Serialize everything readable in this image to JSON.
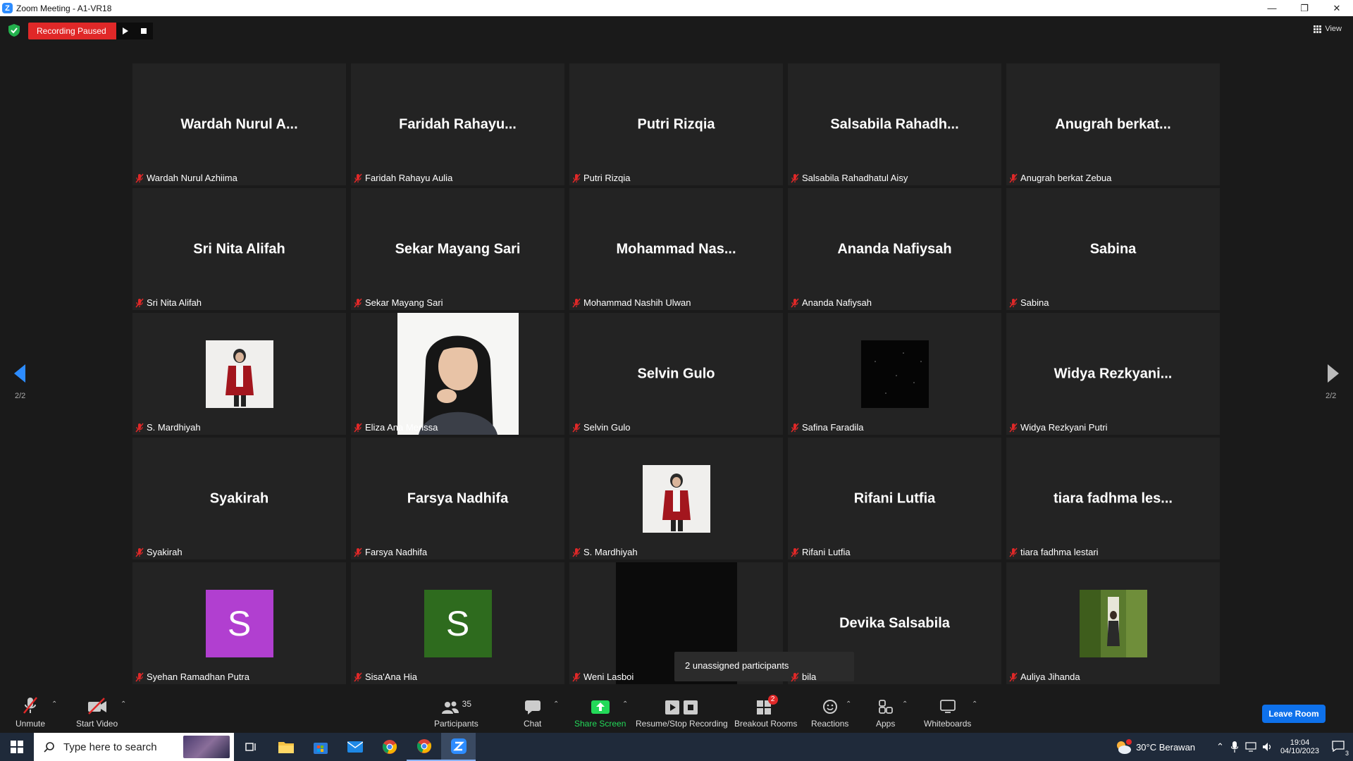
{
  "window": {
    "title": "Zoom Meeting - A1-VR18",
    "minimize": "—",
    "restore": "❐",
    "close": "✕"
  },
  "topbar": {
    "recording_status": "Recording Paused",
    "view_label": "View"
  },
  "pager": {
    "left": "2/2",
    "right": "2/2"
  },
  "tiles": [
    {
      "display": "Wardah  Nurul  A...",
      "name": "Wardah Nurul Azhiima",
      "kind": "name"
    },
    {
      "display": "Faridah  Rahayu...",
      "name": "Faridah Rahayu Aulia",
      "kind": "name"
    },
    {
      "display": "Putri Rizqia",
      "name": "Putri Rizqia",
      "kind": "name"
    },
    {
      "display": "Salsabila  Rahadh...",
      "name": "Salsabila Rahadhatul Aisy",
      "kind": "name"
    },
    {
      "display": "Anugrah  berkat...",
      "name": "Anugrah berkat Zebua",
      "kind": "name"
    },
    {
      "display": "Sri Nita Alifah",
      "name": "Sri Nita Alifah",
      "kind": "name"
    },
    {
      "display": "Sekar Mayang Sari",
      "name": "Sekar Mayang Sari",
      "kind": "name"
    },
    {
      "display": "Mohammad  Nas...",
      "name": "Mohammad Nashih Ulwan",
      "kind": "name"
    },
    {
      "display": "Ananda Nafiysah",
      "name": "Ananda Nafiysah",
      "kind": "name"
    },
    {
      "display": "Sabina",
      "name": "Sabina",
      "kind": "name"
    },
    {
      "display": "",
      "name": "S. Mardhiyah",
      "kind": "photo-red"
    },
    {
      "display": "",
      "name": "Eliza Ana Merissa",
      "kind": "video"
    },
    {
      "display": "Selvin Gulo",
      "name": "Selvin Gulo",
      "kind": "name"
    },
    {
      "display": "",
      "name": "Safina Faradila",
      "kind": "photo-dark"
    },
    {
      "display": "Widya  Rezkyani...",
      "name": "Widya Rezkyani Putri",
      "kind": "name"
    },
    {
      "display": "Syakirah",
      "name": "Syakirah",
      "kind": "name"
    },
    {
      "display": "Farsya Nadhifa",
      "name": "Farsya Nadhifa",
      "kind": "name"
    },
    {
      "display": "",
      "name": "S. Mardhiyah",
      "kind": "photo-red"
    },
    {
      "display": "Rifani Lutfia",
      "name": "Rifani Lutfia",
      "kind": "name"
    },
    {
      "display": "tiara fadhma les...",
      "name": "tiara fadhma lestari",
      "kind": "name"
    },
    {
      "display": "S",
      "name": "Syehan Ramadhan Putra",
      "kind": "letter",
      "color": "#b13fd0"
    },
    {
      "display": "S",
      "name": "Sisa'Ana Hia",
      "kind": "letter",
      "color": "#2e6b1e"
    },
    {
      "display": "",
      "name": "Weni Lasboi",
      "kind": "dark-video"
    },
    {
      "display": "Devika Salsabila",
      "name": "bila",
      "kind": "name"
    },
    {
      "display": "",
      "name": "Auliya Jihanda",
      "kind": "photo-green"
    }
  ],
  "tooltip": "2 unassigned participants",
  "toolbar": {
    "unmute": "Unmute",
    "start_video": "Start Video",
    "participants": "Participants",
    "participants_count": "35",
    "chat": "Chat",
    "share_screen": "Share Screen",
    "recording": "Resume/Stop Recording",
    "breakout": "Breakout Rooms",
    "breakout_badge": "2",
    "reactions": "Reactions",
    "apps": "Apps",
    "whiteboards": "Whiteboards",
    "leave": "Leave Room"
  },
  "taskbar": {
    "search_placeholder": "Type here to search",
    "weather": "30°C  Berawan",
    "time": "19:04",
    "date": "04/10/2023",
    "notif_count": "3"
  },
  "colors": {
    "recording_red": "#e02828",
    "zoom_blue": "#0e71eb",
    "share_green": "#23d959",
    "tile_bg": "#232323"
  }
}
